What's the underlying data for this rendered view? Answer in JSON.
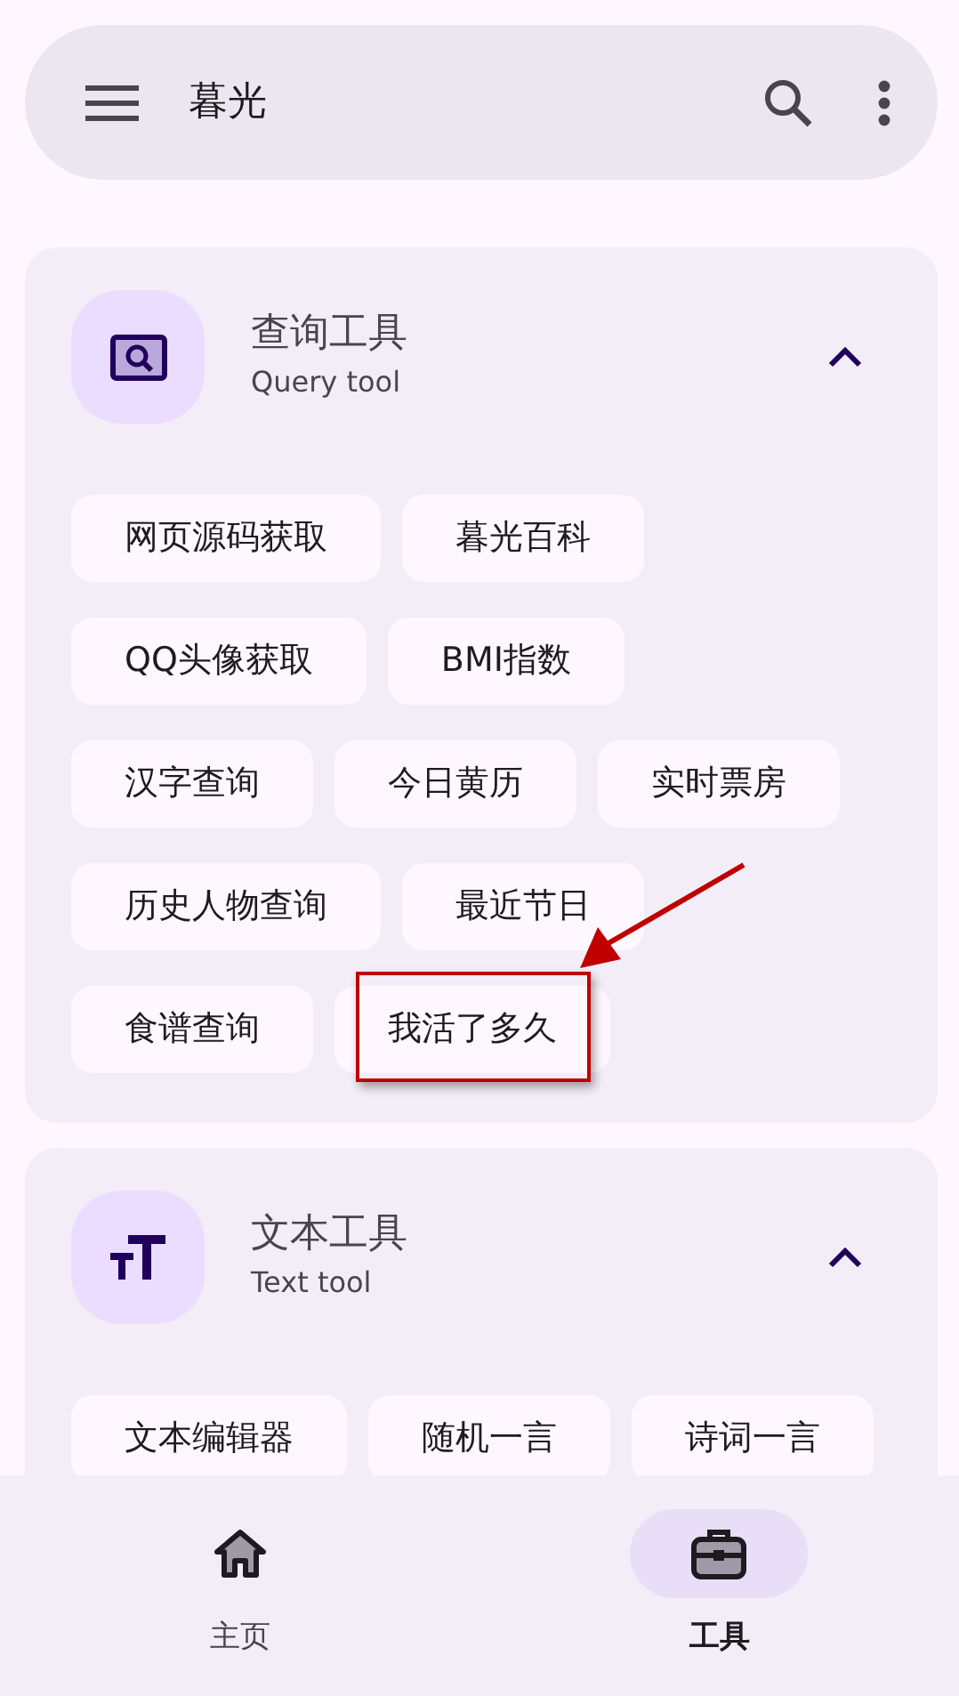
{
  "top_bar": {
    "title": "暮光"
  },
  "sections": [
    {
      "kind": "query",
      "title": "查询工具",
      "subtitle": "Query tool",
      "expanded": true,
      "tools": [
        {
          "label": "网页源码获取",
          "highlighted": false
        },
        {
          "label": "暮光百科",
          "highlighted": false
        },
        {
          "label": "QQ头像获取",
          "highlighted": false
        },
        {
          "label": "BMI指数",
          "highlighted": false
        },
        {
          "label": "汉字查询",
          "highlighted": false
        },
        {
          "label": "今日黄历",
          "highlighted": false
        },
        {
          "label": "实时票房",
          "highlighted": false
        },
        {
          "label": "历史人物查询",
          "highlighted": false
        },
        {
          "label": "最近节日",
          "highlighted": false
        },
        {
          "label": "食谱查询",
          "highlighted": false
        },
        {
          "label": "我活了多久",
          "highlighted": true
        }
      ]
    },
    {
      "kind": "text",
      "title": "文本工具",
      "subtitle": "Text tool",
      "expanded": true,
      "tools": [
        {
          "label": "文本编辑器",
          "highlighted": false
        },
        {
          "label": "随机一言",
          "highlighted": false
        },
        {
          "label": "诗词一言",
          "highlighted": false
        }
      ]
    }
  ],
  "bottom_nav": [
    {
      "kind": "home",
      "label": "主页",
      "selected": false
    },
    {
      "kind": "tools",
      "label": "工具",
      "selected": true
    }
  ]
}
